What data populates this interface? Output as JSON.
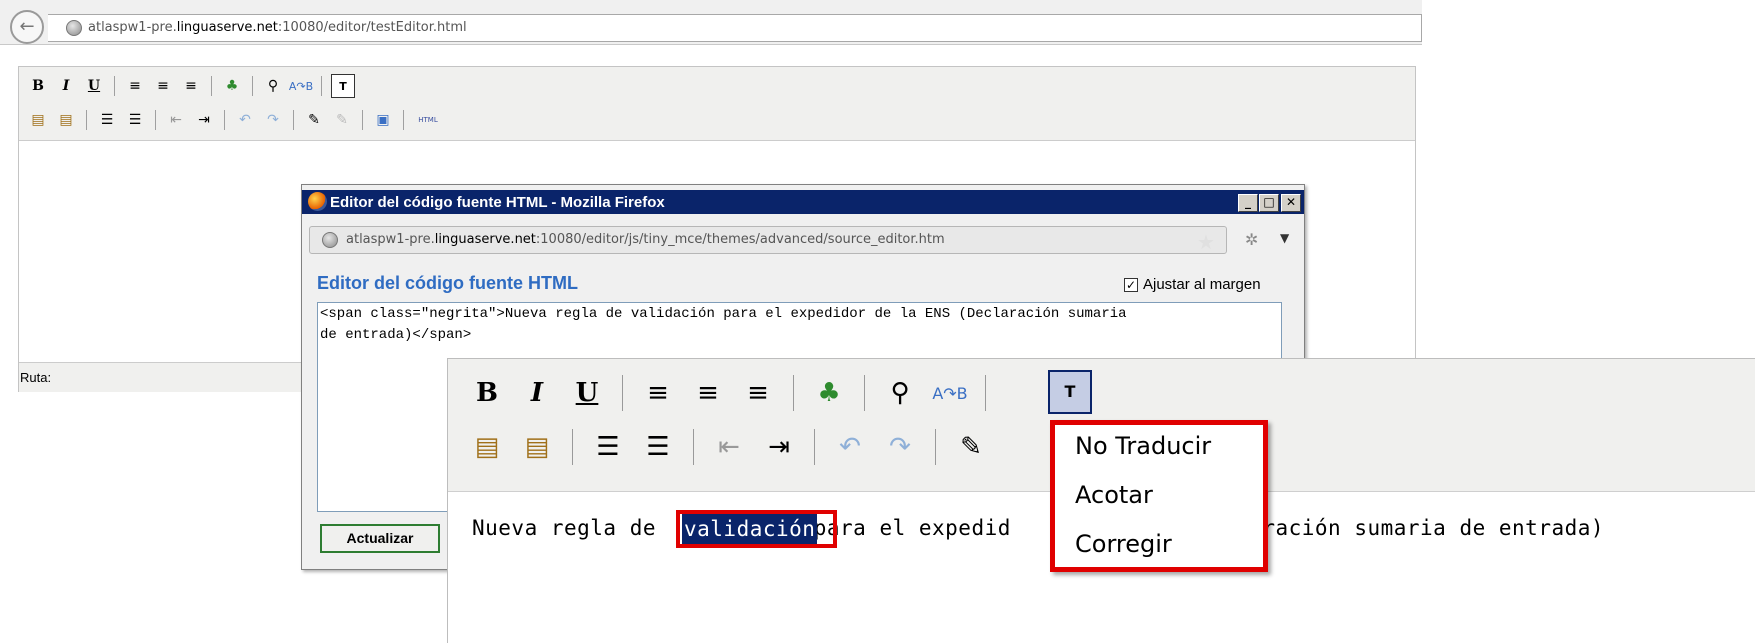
{
  "browser": {
    "url_prefix": "atlaspw1-pre.",
    "url_domain": "linguaserve.net",
    "url_suffix": ":10080/editor/testEditor.html"
  },
  "editor": {
    "toolbar_row1": [
      "B",
      "I",
      "U",
      "≡",
      "≡",
      "≡",
      "🌳",
      "🔍",
      "ᴬᵦ",
      "T"
    ],
    "toolbar_row2_last_label": "HTML",
    "ruta_label": "Ruta:"
  },
  "popup": {
    "window_title": "Editor del código fuente HTML - Mozilla Firefox",
    "url_prefix": "atlaspw1-pre.",
    "url_domain": "linguaserve.net",
    "url_suffix": ":10080/editor/js/tiny_mce/themes/advanced/source_editor.htm",
    "heading": "Editor del código fuente HTML",
    "wrap_label": "Ajustar al margen",
    "wrap_checked": true,
    "source_code": "<span class=\"negrita\">Nueva regla de validación para el expedidor de la ENS (Declaración sumaria\nde entrada)</span>",
    "update_button": "Actualizar",
    "window_buttons": [
      "_",
      "□",
      "✕"
    ]
  },
  "zoom": {
    "content_before": "Nueva regla de ",
    "selected_word": "validación ",
    "content_after_visible": "para el expedid",
    "content_tail_visible": "claración sumaria de entrada)",
    "t_button_label": "T",
    "highlight_color": "#e00000",
    "selection_color": "#0a246a"
  },
  "context_menu": {
    "items": [
      "No Traducir",
      "Acotar",
      "Corregir"
    ]
  }
}
